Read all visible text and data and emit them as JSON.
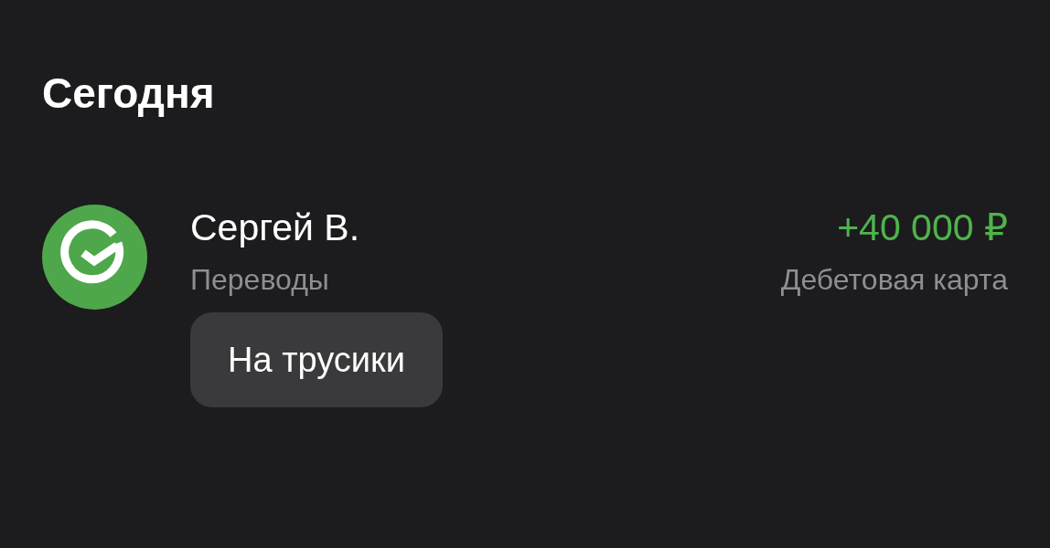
{
  "section_title": "Сегодня",
  "transactions": [
    {
      "name": "Сергей В.",
      "category": "Переводы",
      "amount": "+40 000 ₽",
      "account": "Дебетовая карта",
      "kind": "income",
      "note": "На трусики"
    }
  ]
}
